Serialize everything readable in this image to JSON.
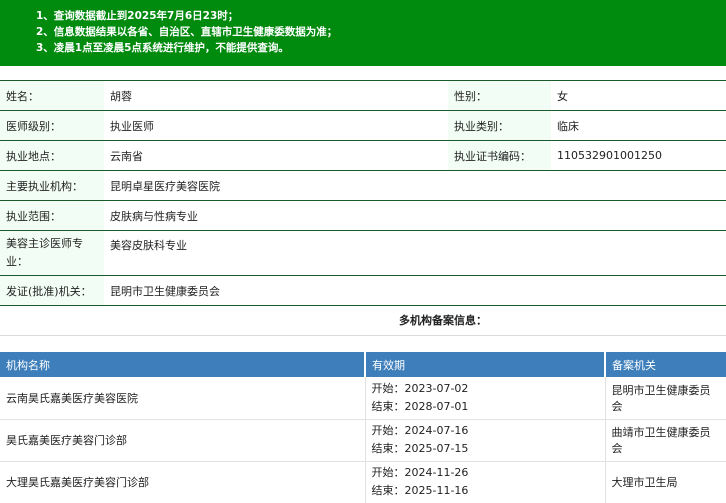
{
  "notice": {
    "lines": [
      "1、查询数据截止到2025年7月6日23时；",
      "2、信息数据结果以各省、自治区、直辖市卫生健康委数据为准；",
      "3、凌晨1点至凌晨5点系统进行维护，不能提供查询。"
    ]
  },
  "info": {
    "name_label": "姓名：",
    "name": "胡蓉",
    "gender_label": "性别：",
    "gender": "女",
    "level_label": "医师级别：",
    "level": "执业医师",
    "category_label": "执业类别：",
    "category": "临床",
    "location_label": "执业地点：",
    "location": "云南省",
    "cert_label": "执业证书编码：",
    "cert": "110532901001250",
    "org_label": "主要执业机构：",
    "org": "昆明卓星医疗美容医院",
    "scope_label": "执业范围：",
    "scope": "皮肤病与性病专业",
    "cosmetic_label": "美容主诊医师专业：",
    "cosmetic": "美容皮肤科专业",
    "issuer_label": "发证(批准)机关：",
    "issuer": "昆明市卫生健康委员会"
  },
  "multi_title": "多机构备案信息：",
  "institutions": {
    "headers": [
      "机构名称",
      "有效期",
      "备案机关"
    ],
    "start_label": "开始：",
    "end_label": "结束：",
    "rows": [
      {
        "name": "云南昊氏嘉美医疗美容医院",
        "start": "2023-07-02",
        "end": "2028-07-01",
        "authority": "昆明市卫生健康委员会"
      },
      {
        "name": "昊氏嘉美医疗美容门诊部",
        "start": "2024-07-16",
        "end": "2025-07-15",
        "authority": "曲靖市卫生健康委员会"
      },
      {
        "name": "大理昊氏嘉美医疗美容门诊部",
        "start": "2024-11-26",
        "end": "2025-11-16",
        "authority": "大理市卫生局"
      }
    ]
  },
  "colors": {
    "notice_bg": "#008a0e",
    "header_bg": "#3e7fbb",
    "label_bg": "#f1fdf5"
  }
}
